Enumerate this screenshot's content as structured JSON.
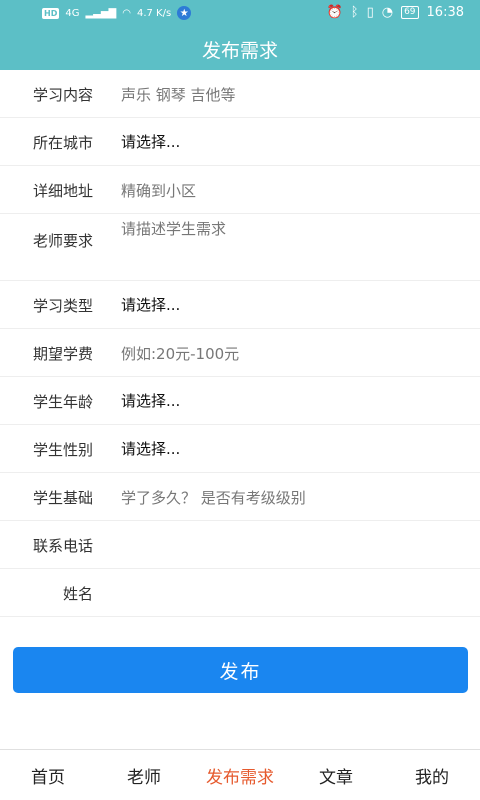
{
  "status": {
    "hd": "HD",
    "net": "4G",
    "speed": "4.7 K/s",
    "battery": "69",
    "time": "16:38"
  },
  "appbar": {
    "title": "发布需求"
  },
  "form": {
    "rows": [
      {
        "label": "学习内容",
        "value": "声乐 钢琴 吉他等",
        "kind": "placeholder"
      },
      {
        "label": "所在城市",
        "value": "请选择...",
        "kind": "select"
      },
      {
        "label": "详细地址",
        "value": "精确到小区",
        "kind": "placeholder"
      },
      {
        "label": "老师要求",
        "value": "请描述学生需求",
        "kind": "textarea"
      },
      {
        "label": "学习类型",
        "value": "请选择...",
        "kind": "select"
      },
      {
        "label": "期望学费",
        "value": "例如:20元-100元",
        "kind": "placeholder"
      },
      {
        "label": "学生年龄",
        "value": "请选择...",
        "kind": "select"
      },
      {
        "label": "学生性别",
        "value": "请选择...",
        "kind": "select"
      },
      {
        "label": "学生基础",
        "value": "学了多久？ 是否有考级级别",
        "kind": "placeholder"
      },
      {
        "label": "联系电话",
        "value": "",
        "kind": "input"
      },
      {
        "label": "姓名",
        "value": "",
        "kind": "input"
      }
    ]
  },
  "submit": {
    "label": "发布"
  },
  "tabs": [
    {
      "label": "首页"
    },
    {
      "label": "老师"
    },
    {
      "label": "发布需求",
      "active": true
    },
    {
      "label": "文章"
    },
    {
      "label": "我的"
    }
  ]
}
